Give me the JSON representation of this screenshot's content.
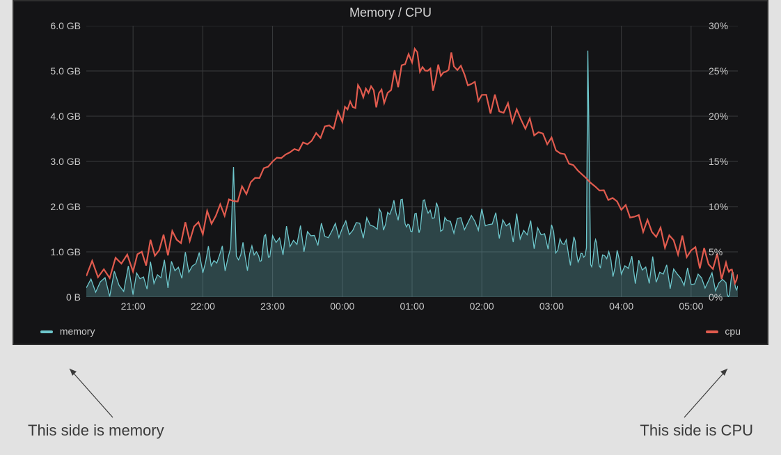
{
  "chart_data": {
    "type": "line",
    "title": "Memory / CPU",
    "x_categories": [
      "21:00",
      "22:00",
      "23:00",
      "00:00",
      "01:00",
      "02:00",
      "03:00",
      "04:00",
      "05:00"
    ],
    "left_axis": {
      "label_series": "memory",
      "unit": "GB",
      "ticks": [
        "0 B",
        "1.0 GB",
        "2.0 GB",
        "3.0 GB",
        "4.0 GB",
        "5.0 GB",
        "6.0 GB"
      ],
      "range": [
        0,
        6
      ]
    },
    "right_axis": {
      "label_series": "cpu",
      "unit": "%",
      "ticks": [
        "0%",
        "5%",
        "10%",
        "15%",
        "20%",
        "25%",
        "30%"
      ],
      "range": [
        0,
        30
      ]
    },
    "series": [
      {
        "name": "memory",
        "axis": "left",
        "color": "#6ec7cc",
        "style": "area",
        "x": [
          20.33,
          21,
          21.5,
          22,
          22.4,
          22.44,
          22.48,
          22.8,
          23,
          23.5,
          24,
          24.5,
          24.8,
          25,
          25.2,
          25.5,
          26,
          26.5,
          27,
          27.3,
          27.5,
          27.52,
          27.56,
          27.7,
          28,
          28.5,
          29,
          29.5,
          29.67
        ],
        "y": [
          0.25,
          0.35,
          0.55,
          0.8,
          0.9,
          3.0,
          0.9,
          0.95,
          1.2,
          1.3,
          1.5,
          1.6,
          2.0,
          1.5,
          2.0,
          1.6,
          1.7,
          1.5,
          1.3,
          1.0,
          0.95,
          5.3,
          0.95,
          0.9,
          0.7,
          0.55,
          0.4,
          0.3,
          0.25
        ]
      },
      {
        "name": "cpu",
        "axis": "right",
        "color": "#e15b4e",
        "style": "line",
        "x": [
          20.33,
          21,
          21.5,
          22,
          22.5,
          23,
          23.5,
          24,
          24.3,
          24.6,
          25,
          25.3,
          25.6,
          26,
          26.5,
          27,
          27.5,
          28,
          28.5,
          29,
          29.5,
          29.67
        ],
        "y": [
          2.5,
          4,
          6,
          8,
          11,
          15,
          17,
          20,
          23,
          22,
          27,
          24,
          26,
          22,
          20,
          17,
          13,
          10,
          7,
          5,
          3,
          2.5
        ]
      }
    ],
    "legend": {
      "left": {
        "label": "memory",
        "color": "#6ec7cc"
      },
      "right": {
        "label": "cpu",
        "color": "#e15b4e"
      }
    }
  },
  "annotations": {
    "left_text": "This side is memory",
    "right_text": "This side is CPU"
  }
}
